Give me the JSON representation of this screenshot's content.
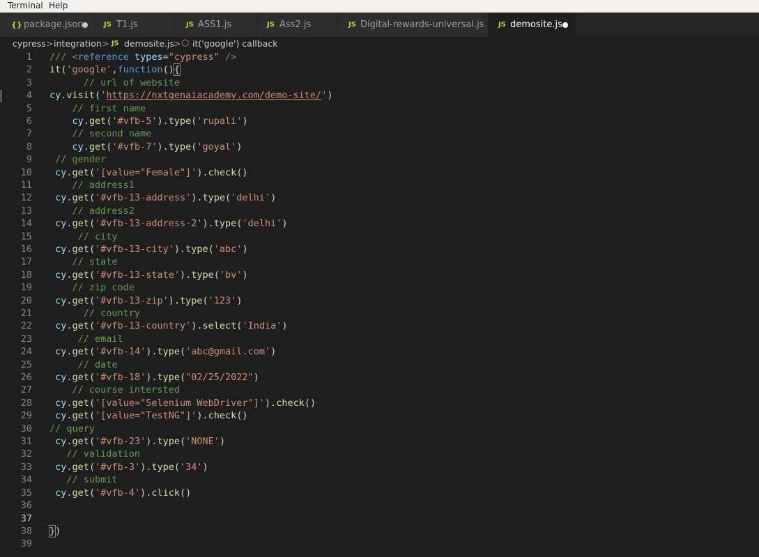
{
  "menubar": {
    "items": [
      "Terminal",
      "Help"
    ]
  },
  "tabs": [
    {
      "icon": "{}",
      "label": "package.json",
      "modified": true,
      "active": false
    },
    {
      "icon": "JS",
      "label": "T1.js",
      "modified": false,
      "active": false
    },
    {
      "icon": "JS",
      "label": "ASS1.js",
      "modified": false,
      "active": false
    },
    {
      "icon": "JS",
      "label": "Ass2.js",
      "modified": false,
      "active": false
    },
    {
      "icon": "JS",
      "label": "Digital-rewards-universal.js",
      "modified": false,
      "active": false
    },
    {
      "icon": "JS",
      "label": "demosite.js",
      "modified": true,
      "active": true
    }
  ],
  "breadcrumb": {
    "parts": [
      "cypress",
      "integration",
      "demosite.js",
      "it('google') callback"
    ],
    "js_icon": "JS",
    "separator": ">"
  },
  "editor": {
    "current_line": 37,
    "lines": [
      [
        [
          "c",
          "///"
        ],
        [
          "p",
          " "
        ],
        [
          "g",
          "<"
        ],
        [
          "t",
          "reference"
        ],
        [
          "p",
          " "
        ],
        [
          "a",
          "types"
        ],
        [
          "p",
          "="
        ],
        [
          "s",
          "\"cypress\""
        ],
        [
          "p",
          " "
        ],
        [
          "g",
          "/>"
        ]
      ],
      [
        [
          "f",
          "it"
        ],
        [
          "p",
          "("
        ],
        [
          "s",
          "'google'"
        ],
        [
          "p",
          ","
        ],
        [
          "k",
          "function"
        ],
        [
          "p",
          "()"
        ],
        [
          "b",
          "{"
        ]
      ],
      [
        [
          "p",
          "      "
        ],
        [
          "c",
          "// url of website"
        ]
      ],
      [
        [
          "v",
          "cy"
        ],
        [
          "p",
          "."
        ],
        [
          "f",
          "visit"
        ],
        [
          "p",
          "("
        ],
        [
          "s",
          "'"
        ],
        [
          "u",
          "https://nxtgenaiacademy.com/demo-site/"
        ],
        [
          "s",
          "'"
        ],
        [
          "p",
          ")"
        ]
      ],
      [
        [
          "p",
          "    "
        ],
        [
          "c",
          "// first name"
        ]
      ],
      [
        [
          "p",
          "    "
        ],
        [
          "v",
          "cy"
        ],
        [
          "p",
          "."
        ],
        [
          "f",
          "get"
        ],
        [
          "p",
          "("
        ],
        [
          "s",
          "'#vfb-5'"
        ],
        [
          "p",
          ")."
        ],
        [
          "f",
          "type"
        ],
        [
          "p",
          "("
        ],
        [
          "s",
          "'rupali'"
        ],
        [
          "p",
          ")"
        ]
      ],
      [
        [
          "p",
          "    "
        ],
        [
          "c",
          "// second name"
        ]
      ],
      [
        [
          "p",
          "    "
        ],
        [
          "v",
          "cy"
        ],
        [
          "p",
          "."
        ],
        [
          "f",
          "get"
        ],
        [
          "p",
          "("
        ],
        [
          "s",
          "'#vfb-7'"
        ],
        [
          "p",
          ")."
        ],
        [
          "f",
          "type"
        ],
        [
          "p",
          "("
        ],
        [
          "s",
          "'goyal'"
        ],
        [
          "p",
          ")"
        ]
      ],
      [
        [
          "p",
          " "
        ],
        [
          "c",
          "// gender"
        ]
      ],
      [
        [
          "p",
          " "
        ],
        [
          "v",
          "cy"
        ],
        [
          "p",
          "."
        ],
        [
          "f",
          "get"
        ],
        [
          "p",
          "("
        ],
        [
          "s",
          "'[value=\"Female\"]'"
        ],
        [
          "p",
          ")."
        ],
        [
          "f",
          "check"
        ],
        [
          "p",
          "()"
        ]
      ],
      [
        [
          "p",
          "    "
        ],
        [
          "c",
          "// address1"
        ]
      ],
      [
        [
          "p",
          " "
        ],
        [
          "v",
          "cy"
        ],
        [
          "p",
          "."
        ],
        [
          "f",
          "get"
        ],
        [
          "p",
          "("
        ],
        [
          "s",
          "'#vfb-13-address'"
        ],
        [
          "p",
          ")."
        ],
        [
          "f",
          "type"
        ],
        [
          "p",
          "("
        ],
        [
          "s",
          "'delhi'"
        ],
        [
          "p",
          ")"
        ]
      ],
      [
        [
          "p",
          "    "
        ],
        [
          "c",
          "// address2"
        ]
      ],
      [
        [
          "p",
          " "
        ],
        [
          "v",
          "cy"
        ],
        [
          "p",
          "."
        ],
        [
          "f",
          "get"
        ],
        [
          "p",
          "("
        ],
        [
          "s",
          "'#vfb-13-address-2'"
        ],
        [
          "p",
          ")."
        ],
        [
          "f",
          "type"
        ],
        [
          "p",
          "("
        ],
        [
          "s",
          "'delhi'"
        ],
        [
          "p",
          ")"
        ]
      ],
      [
        [
          "p",
          "     "
        ],
        [
          "c",
          "// city"
        ]
      ],
      [
        [
          "p",
          " "
        ],
        [
          "v",
          "cy"
        ],
        [
          "p",
          "."
        ],
        [
          "f",
          "get"
        ],
        [
          "p",
          "("
        ],
        [
          "s",
          "'#vfb-13-city'"
        ],
        [
          "p",
          ")."
        ],
        [
          "f",
          "type"
        ],
        [
          "p",
          "("
        ],
        [
          "s",
          "'abc'"
        ],
        [
          "p",
          ")"
        ]
      ],
      [
        [
          "p",
          "    "
        ],
        [
          "c",
          "// state"
        ]
      ],
      [
        [
          "p",
          " "
        ],
        [
          "v",
          "cy"
        ],
        [
          "p",
          "."
        ],
        [
          "f",
          "get"
        ],
        [
          "p",
          "("
        ],
        [
          "s",
          "'#vfb-13-state'"
        ],
        [
          "p",
          ")."
        ],
        [
          "f",
          "type"
        ],
        [
          "p",
          "("
        ],
        [
          "s",
          "'bv'"
        ],
        [
          "p",
          ")"
        ]
      ],
      [
        [
          "p",
          "    "
        ],
        [
          "c",
          "// zip code"
        ]
      ],
      [
        [
          "p",
          " "
        ],
        [
          "v",
          "cy"
        ],
        [
          "p",
          "."
        ],
        [
          "f",
          "get"
        ],
        [
          "p",
          "("
        ],
        [
          "s",
          "'#vfb-13-zip'"
        ],
        [
          "p",
          ")."
        ],
        [
          "f",
          "type"
        ],
        [
          "p",
          "("
        ],
        [
          "s",
          "'123'"
        ],
        [
          "p",
          ")"
        ]
      ],
      [
        [
          "p",
          "      "
        ],
        [
          "c",
          "// country"
        ]
      ],
      [
        [
          "p",
          " "
        ],
        [
          "v",
          "cy"
        ],
        [
          "p",
          "."
        ],
        [
          "f",
          "get"
        ],
        [
          "p",
          "("
        ],
        [
          "s",
          "'#vfb-13-country'"
        ],
        [
          "p",
          ")."
        ],
        [
          "f",
          "select"
        ],
        [
          "p",
          "("
        ],
        [
          "s",
          "'India'"
        ],
        [
          "p",
          ")"
        ]
      ],
      [
        [
          "p",
          "     "
        ],
        [
          "c",
          "// email"
        ]
      ],
      [
        [
          "p",
          " "
        ],
        [
          "v",
          "cy"
        ],
        [
          "p",
          "."
        ],
        [
          "f",
          "get"
        ],
        [
          "p",
          "("
        ],
        [
          "s",
          "'#vfb-14'"
        ],
        [
          "p",
          ")."
        ],
        [
          "f",
          "type"
        ],
        [
          "p",
          "("
        ],
        [
          "s",
          "'abc@gmail.com'"
        ],
        [
          "p",
          ")"
        ]
      ],
      [
        [
          "p",
          "     "
        ],
        [
          "c",
          "// date"
        ]
      ],
      [
        [
          "p",
          " "
        ],
        [
          "v",
          "cy"
        ],
        [
          "p",
          "."
        ],
        [
          "f",
          "get"
        ],
        [
          "p",
          "("
        ],
        [
          "s",
          "'#vfb-18'"
        ],
        [
          "p",
          ")."
        ],
        [
          "f",
          "type"
        ],
        [
          "p",
          "("
        ],
        [
          "s",
          "\"02/25/2022\""
        ],
        [
          "p",
          ")"
        ]
      ],
      [
        [
          "p",
          "    "
        ],
        [
          "c",
          "// course intersted"
        ]
      ],
      [
        [
          "p",
          " "
        ],
        [
          "v",
          "cy"
        ],
        [
          "p",
          "."
        ],
        [
          "f",
          "get"
        ],
        [
          "p",
          "("
        ],
        [
          "s",
          "'[value=\"Selenium WebDriver\"]'"
        ],
        [
          "p",
          ")."
        ],
        [
          "f",
          "check"
        ],
        [
          "p",
          "()"
        ]
      ],
      [
        [
          "p",
          " "
        ],
        [
          "v",
          "cy"
        ],
        [
          "p",
          "."
        ],
        [
          "f",
          "get"
        ],
        [
          "p",
          "("
        ],
        [
          "s",
          "'[value=\"TestNG\"]'"
        ],
        [
          "p",
          ")."
        ],
        [
          "f",
          "check"
        ],
        [
          "p",
          "()"
        ]
      ],
      [
        [
          "c",
          "// query"
        ]
      ],
      [
        [
          "p",
          " "
        ],
        [
          "v",
          "cy"
        ],
        [
          "p",
          "."
        ],
        [
          "f",
          "get"
        ],
        [
          "p",
          "("
        ],
        [
          "s",
          "'#vfb-23'"
        ],
        [
          "p",
          ")."
        ],
        [
          "f",
          "type"
        ],
        [
          "p",
          "("
        ],
        [
          "s",
          "'NONE'"
        ],
        [
          "p",
          ")"
        ]
      ],
      [
        [
          "p",
          "   "
        ],
        [
          "c",
          "// validation"
        ]
      ],
      [
        [
          "p",
          " "
        ],
        [
          "v",
          "cy"
        ],
        [
          "p",
          "."
        ],
        [
          "f",
          "get"
        ],
        [
          "p",
          "("
        ],
        [
          "s",
          "'#vfb-3'"
        ],
        [
          "p",
          ")."
        ],
        [
          "f",
          "type"
        ],
        [
          "p",
          "("
        ],
        [
          "s",
          "'34'"
        ],
        [
          "p",
          ")"
        ]
      ],
      [
        [
          "p",
          "   "
        ],
        [
          "c",
          "// submit"
        ]
      ],
      [
        [
          "p",
          " "
        ],
        [
          "v",
          "cy"
        ],
        [
          "p",
          "."
        ],
        [
          "f",
          "get"
        ],
        [
          "p",
          "("
        ],
        [
          "s",
          "'#vfb-4'"
        ],
        [
          "p",
          ")."
        ],
        [
          "f",
          "click"
        ],
        [
          "p",
          "()"
        ]
      ],
      [],
      [],
      [
        [
          "b",
          "}"
        ],
        [
          "p",
          ")"
        ]
      ],
      []
    ]
  }
}
